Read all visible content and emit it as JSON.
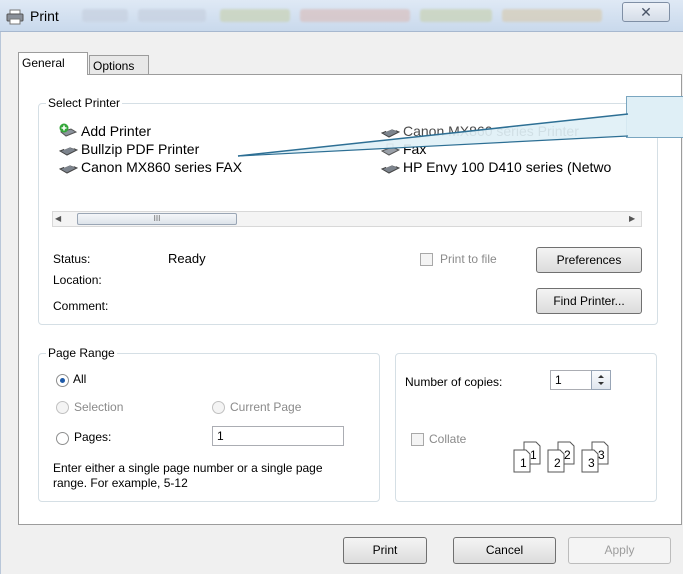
{
  "window": {
    "title": "Print",
    "close_glyph": "✕"
  },
  "tabs": [
    {
      "label": "General",
      "active": true
    },
    {
      "label": "Options",
      "active": false
    }
  ],
  "select_printer": {
    "legend": "Select Printer",
    "printers": [
      {
        "name": "Add Printer",
        "icon": "add-printer-icon"
      },
      {
        "name": "Bullzip PDF Printer",
        "icon": "printer-icon"
      },
      {
        "name": "Canon MX860 series FAX",
        "icon": "fax-printer-icon"
      },
      {
        "name": "Canon MX860 series Printer",
        "icon": "printer-icon"
      },
      {
        "name": "Fax",
        "icon": "fax-icon"
      },
      {
        "name": "HP Envy 100 D410 series (Netwo",
        "icon": "printer-icon"
      }
    ],
    "scroll_thumb": "III",
    "status_label": "Status:",
    "status_value": "Ready",
    "location_label": "Location:",
    "comment_label": "Comment:",
    "print_to_file_label": "Print to file",
    "preferences_label": "Preferences",
    "find_printer_label": "Find Printer..."
  },
  "page_range": {
    "legend": "Page Range",
    "all_label": "All",
    "selection_label": "Selection",
    "current_page_label": "Current Page",
    "pages_label": "Pages:",
    "pages_value": "1",
    "help_text": "Enter either a single page number or a single page range.  For example, 5-12"
  },
  "copies": {
    "number_label": "Number of copies:",
    "number_value": "1",
    "collate_label": "Collate",
    "collate_pages": [
      "1",
      "1",
      "2",
      "2",
      "3",
      "3"
    ]
  },
  "footer": {
    "print_label": "Print",
    "cancel_label": "Cancel",
    "apply_label": "Apply"
  }
}
